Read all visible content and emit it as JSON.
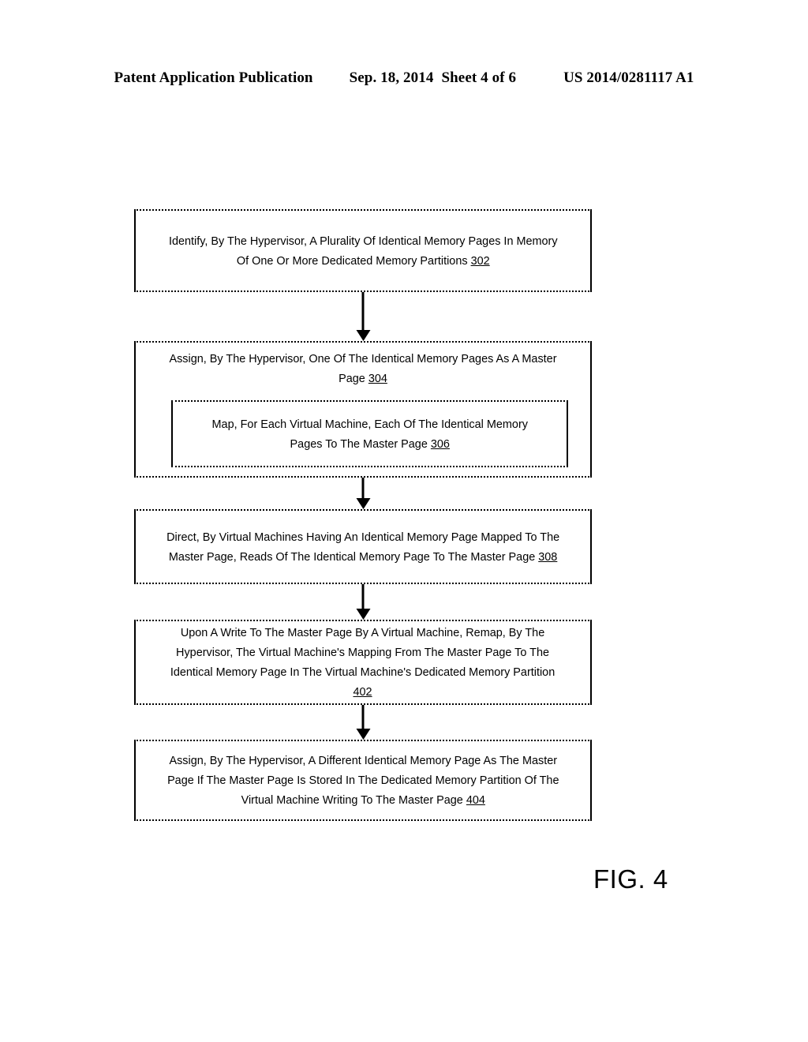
{
  "header": {
    "publication": "Patent Application Publication",
    "date": "Sep. 18, 2014",
    "sheet": "Sheet 4 of 6",
    "patent_number": "US 2014/0281117 A1"
  },
  "figure": {
    "label": "FIG. 4"
  },
  "flowchart": {
    "steps": [
      {
        "id": "302",
        "text": "Identify, By The Hypervisor, A Plurality Of Identical Memory Pages In Memory\nOf One Or More Dedicated Memory Partitions ",
        "ref": "302"
      },
      {
        "id": "304",
        "text": "Assign, By The Hypervisor, One Of The Identical Memory Pages As A Master\nPage ",
        "ref": "304"
      },
      {
        "id": "306",
        "text": "Map, For Each Virtual Machine, Each Of The Identical Memory\nPages To The Master Page ",
        "ref": "306"
      },
      {
        "id": "308",
        "text": "Direct, By Virtual Machines Having An Identical Memory Page Mapped To The\nMaster Page, Reads Of The Identical Memory Page To The Master Page  ",
        "ref": "308"
      },
      {
        "id": "402",
        "text": "Upon A Write To The Master Page By A Virtual Machine, Remap, By The\nHypervisor, The Virtual Machine's Mapping From The Master Page To The\nIdentical Memory Page In The Virtual Machine's Dedicated Memory Partition\n",
        "ref": "402"
      },
      {
        "id": "404",
        "text": "Assign, By The Hypervisor, A Different Identical Memory Page As The Master\nPage If The Master Page Is Stored In The Dedicated Memory Partition Of The\nVirtual Machine Writing To The Master Page ",
        "ref": "404"
      }
    ]
  },
  "colors": {
    "ink": "#000000",
    "paper": "#ffffff"
  }
}
